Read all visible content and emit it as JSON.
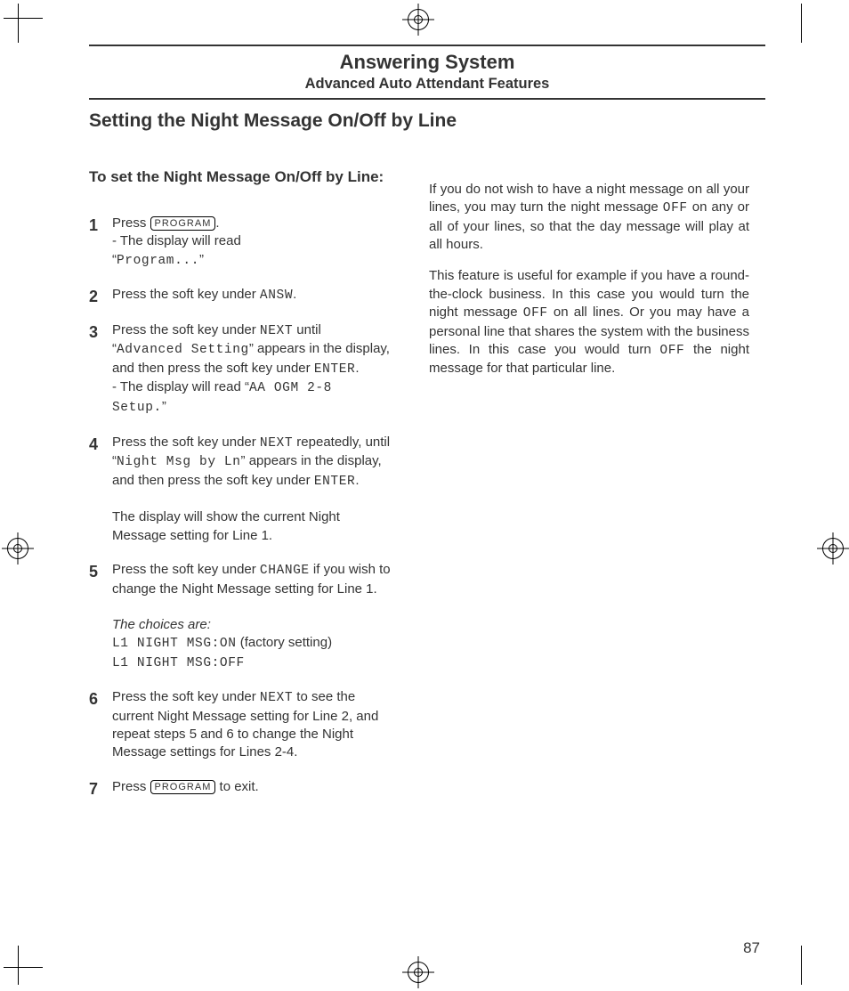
{
  "header": {
    "title": "Answering System",
    "subtitle": "Advanced Auto Attendant Features"
  },
  "section_title": "Setting the Night Message On/Off by Line",
  "left": {
    "subhead": "To set the Night Message On/Off by Line:",
    "btn": {
      "program": "PROGRAM"
    },
    "lcd": {
      "program": "Program...",
      "answ": "ANSW",
      "next": "NEXT",
      "advanced": "Advanced Setting",
      "enter": "ENTER",
      "aaogm": "AA OGM 2-8 Setup.",
      "nightmsg": "Night Msg by Ln",
      "change": "CHANGE",
      "on": "L1 NIGHT MSG:ON",
      "off_line": "L1 NIGHT MSG:OFF",
      "off": "OFF"
    },
    "txt": {
      "press": "Press ",
      "period": ".",
      "display_read": "- The display will read",
      "q1": "“",
      "q2": "”",
      "s2": "Press the soft key under ",
      "s3a": " until ",
      "s3b": " appears in the display, and then press the soft key under ",
      "s3c": "- The display will read ",
      "s4a": " repeatedly, until ",
      "s4b": " appears in the display, and then press the soft key under ",
      "s4c": "The display will show the current Night Message setting for Line 1.",
      "s5a": " if you wish to change the Night Message setting for Line 1.",
      "s5choices": "The choices are:",
      "s5fac": " (factory setting)",
      "s6": " to see the current Night Message setting for Line 2, and repeat steps 5 and 6 to change the Night Message settings for Lines 2-4.",
      "s7": "  to exit."
    }
  },
  "right": {
    "p1a": "If you do not wish to have a night message on all your lines, you may turn the night message ",
    "p1b": " on any or all of your lines, so that the day message will play at all hours.",
    "p2a": "This feature is useful for example if you have a round-the-clock business. In this case you would turn the night message ",
    "p2b": " on all lines. Or you may have a personal line that shares the system with the business lines. In this case you would turn ",
    "p2c": " the night message for that particular line."
  },
  "page_number": "87"
}
